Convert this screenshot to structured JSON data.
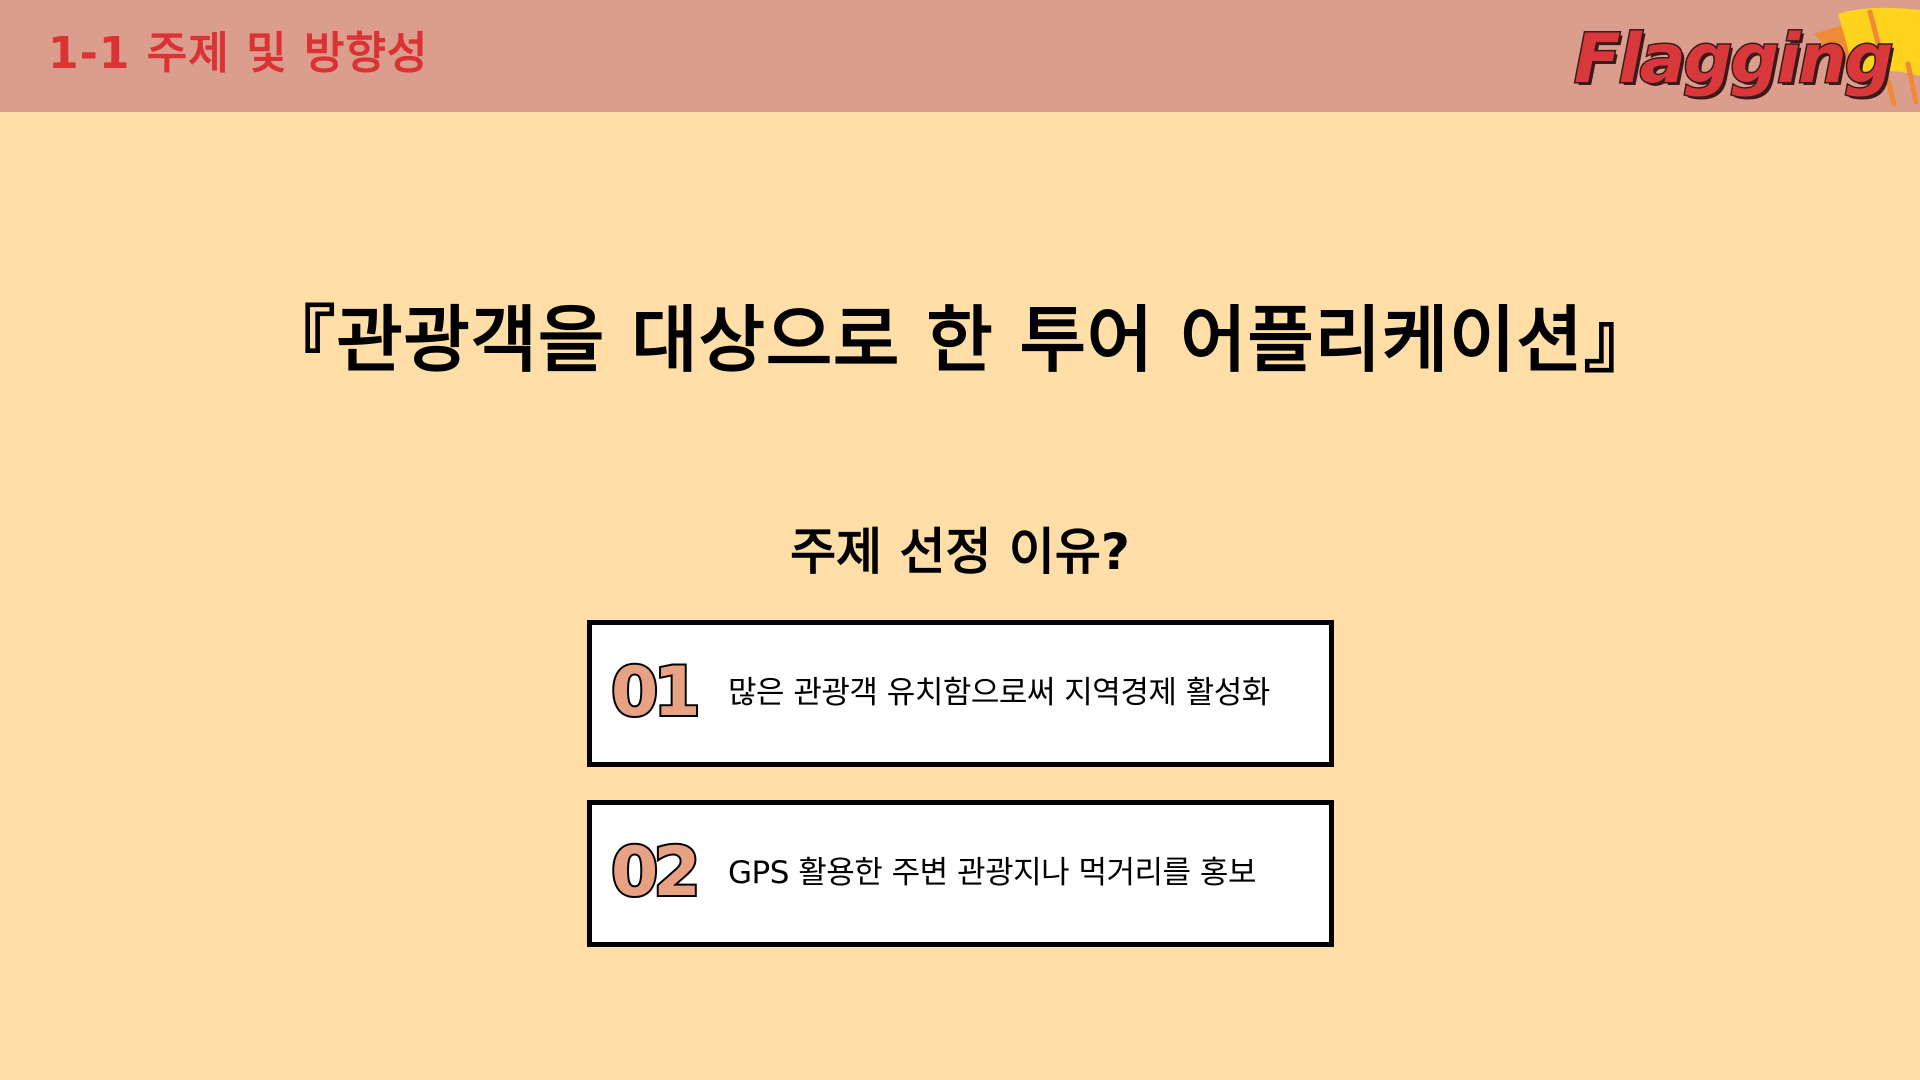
{
  "header": {
    "section_title": "1-1 주제 및 방향성",
    "logo_text": "Flagging"
  },
  "main": {
    "title": "『관광객을 대상으로 한 투어 어플리케이션』",
    "subtitle": "주제 선정 이유?",
    "reasons": [
      {
        "number": "01",
        "text": "많은 관광객 유치함으로써 지역경제 활성화"
      },
      {
        "number": "02",
        "text": "GPS 활용한 주변 관광지나 먹거리를 홍보"
      }
    ]
  },
  "colors": {
    "background": "#FFDEA7",
    "header_bar": "#DB9E8D",
    "section_title": "#DA3235",
    "logo_red": "#D9383A",
    "flag_yellow": "#FFD21E",
    "flag_orange": "#F08A34",
    "number_fill": "#E9A183",
    "card_border": "#000000",
    "card_fill": "#FFFFFF"
  },
  "icons": {
    "logo_flag": "flag-icon"
  }
}
